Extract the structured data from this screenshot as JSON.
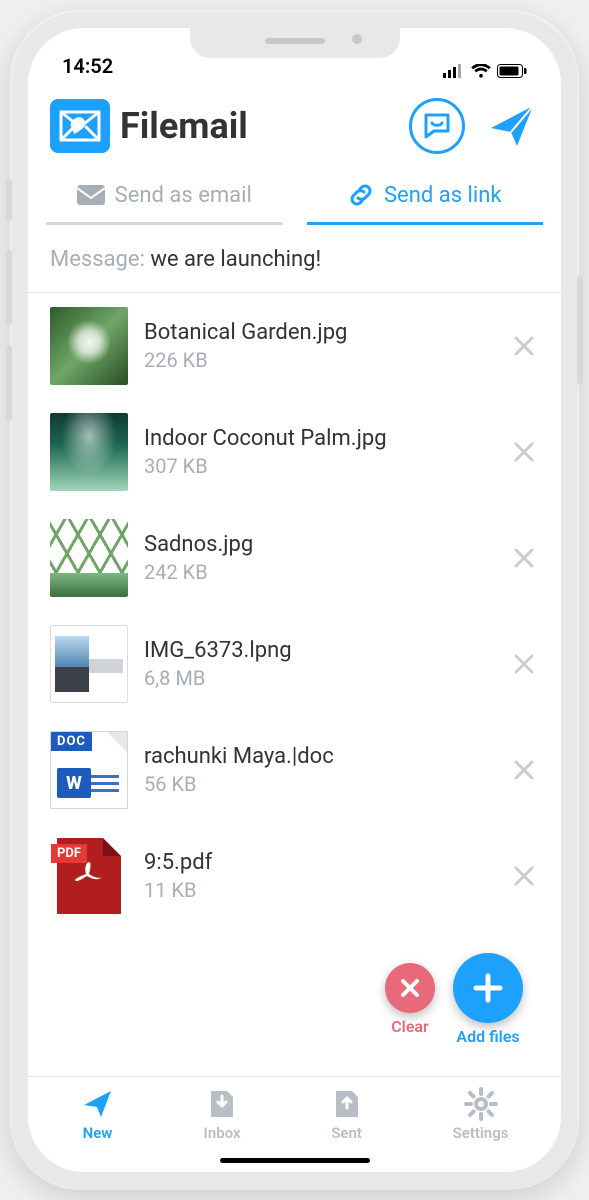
{
  "status": {
    "time": "14:52"
  },
  "brand": {
    "name": "Filemail"
  },
  "tabs": {
    "email": {
      "label": "Send as email",
      "active": false
    },
    "link": {
      "label": "Send as link",
      "active": true
    }
  },
  "message": {
    "label": "Message:",
    "value": "we are launching!"
  },
  "files": [
    {
      "name": "Botanical Garden.jpg",
      "size": "226 KB"
    },
    {
      "name": "Indoor Coconut Palm.jpg",
      "size": "307 KB"
    },
    {
      "name": "Sadnos.jpg",
      "size": "242 KB"
    },
    {
      "name": "IMG_6373.lpng",
      "size": "6,8 MB"
    },
    {
      "name": "rachunki Maya.|doc",
      "size": "56 KB"
    },
    {
      "name": "9:5.pdf",
      "size": "11 KB"
    }
  ],
  "fab": {
    "clear": "Clear",
    "add": "Add files"
  },
  "nav": {
    "new": {
      "label": "New",
      "active": true
    },
    "inbox": {
      "label": "Inbox",
      "active": false
    },
    "sent": {
      "label": "Sent",
      "active": false
    },
    "settings": {
      "label": "Settings",
      "active": false
    }
  },
  "icons": {
    "doc_badge": "DOC",
    "pdf_label": "PDF",
    "word_w": "W"
  }
}
